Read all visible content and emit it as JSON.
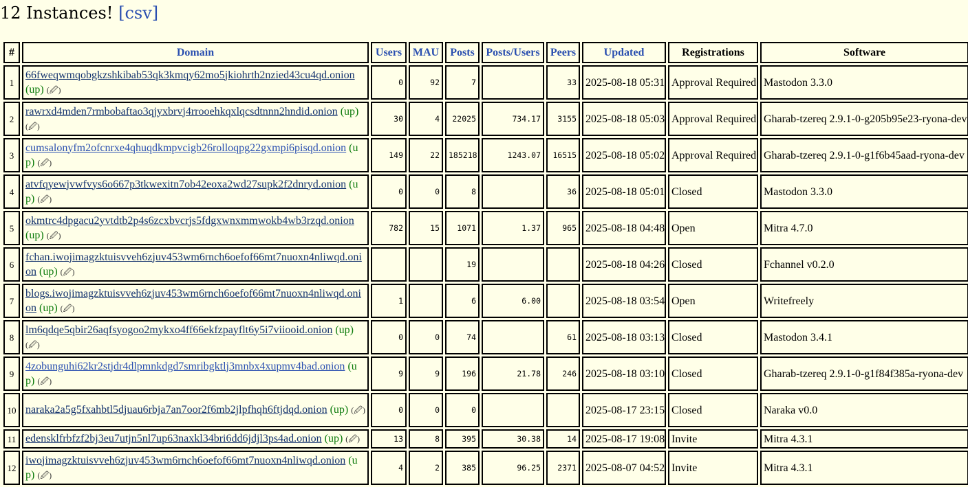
{
  "heading": {
    "count_text": "12 Instances!",
    "csv_link": "[csv]"
  },
  "columns": [
    {
      "label": "#",
      "sortable": false
    },
    {
      "label": "Domain",
      "sortable": true
    },
    {
      "label": "Users",
      "sortable": true
    },
    {
      "label": "MAU",
      "sortable": true
    },
    {
      "label": "Posts",
      "sortable": true
    },
    {
      "label": "Posts/Users",
      "sortable": true
    },
    {
      "label": "Peers",
      "sortable": true
    },
    {
      "label": "Updated",
      "sortable": true
    },
    {
      "label": "Registrations",
      "sortable": false
    },
    {
      "label": "Software",
      "sortable": false
    }
  ],
  "status_text": "(up)",
  "icons": {
    "edit": "pencil-icon"
  },
  "colors": {
    "background": "#ffffe8",
    "link": "#2a4fb0",
    "domain": "#14336e",
    "status": "#0a7a0a"
  },
  "rows": [
    {
      "num": "1",
      "domain": "66fweqwmqobgkzshkibab53qk3kmqy62mo5jkiohrth2nzied43cu4qd.onion",
      "users": "0",
      "mau": "92",
      "posts": "7",
      "posts_per_user": "",
      "peers": "33",
      "updated": "2025-08-18 05:31",
      "registrations": "Approval Required",
      "software": "Mastodon 3.3.0"
    },
    {
      "num": "2",
      "domain": "rawrxd4mden7rmbobaftao3qjyxbrvj4rrooehkqxlqcsdtnnn2hndid.onion",
      "users": "30",
      "mau": "4",
      "posts": "22025",
      "posts_per_user": "734.17",
      "peers": "3155",
      "updated": "2025-08-18 05:03",
      "registrations": "Approval Required",
      "software": "Gharab-tzereq 2.9.1-0-g205b95e23-ryona-dev"
    },
    {
      "num": "3",
      "domain": "cumsalonyfm2ofcnrxe4qhuqdkmpvcigb26rolloqpg22gxmpi6pisqd.onion",
      "users": "149",
      "mau": "22",
      "posts": "185218",
      "posts_per_user": "1243.07",
      "peers": "16515",
      "updated": "2025-08-18 05:02",
      "registrations": "Approval Required",
      "software": "Gharab-tzereq 2.9.1-0-g1f6b45aad-ryona-dev"
    },
    {
      "num": "4",
      "domain": "atvfqyewjvwfvys6o667p3tkwexitn7ob42eoxa2wd27supk2f2dnryd.onion",
      "users": "0",
      "mau": "0",
      "posts": "8",
      "posts_per_user": "",
      "peers": "36",
      "updated": "2025-08-18 05:01",
      "registrations": "Closed",
      "software": "Mastodon 3.3.0"
    },
    {
      "num": "5",
      "domain": "okmtrc4dpgacu2yvtdtb2p4s6zcxbvcrjs5fdgxwnxmmwokb4wb3rzqd.onion",
      "users": "782",
      "mau": "15",
      "posts": "1071",
      "posts_per_user": "1.37",
      "peers": "965",
      "updated": "2025-08-18 04:48",
      "registrations": "Open",
      "software": "Mitra 4.7.0"
    },
    {
      "num": "6",
      "domain": "fchan.iwojimagzktuisvveh6zjuv453wm6rnch6oefof66mt7nuoxn4nliwqd.onion",
      "users": "",
      "mau": "",
      "posts": "19",
      "posts_per_user": "",
      "peers": "",
      "updated": "2025-08-18 04:26",
      "registrations": "Closed",
      "software": "Fchannel v0.2.0"
    },
    {
      "num": "7",
      "domain": "blogs.iwojimagzktuisvveh6zjuv453wm6rnch6oefof66mt7nuoxn4nliwqd.onion",
      "users": "1",
      "mau": "",
      "posts": "6",
      "posts_per_user": "6.00",
      "peers": "",
      "updated": "2025-08-18 03:54",
      "registrations": "Open",
      "software": "Writefreely"
    },
    {
      "num": "8",
      "domain": "lm6qdqe5qbir26aqfsyogoo2mykxo4ff66ekfzpayflt6y5i7viiooid.onion",
      "users": "0",
      "mau": "0",
      "posts": "74",
      "posts_per_user": "",
      "peers": "61",
      "updated": "2025-08-18 03:13",
      "registrations": "Closed",
      "software": "Mastodon 3.4.1"
    },
    {
      "num": "9",
      "domain": "4zobunguhi62kr2stjdr4dlpmnkdgd7smribgktlj3mnbx4xupmv4bad.onion",
      "users": "9",
      "mau": "9",
      "posts": "196",
      "posts_per_user": "21.78",
      "peers": "246",
      "updated": "2025-08-18 03:10",
      "registrations": "Closed",
      "software": "Gharab-tzereq 2.9.1-0-g1f84f385a-ryona-dev"
    },
    {
      "num": "10",
      "domain": "naraka2a5g5fxahbtl5djuau6rbja7an7oor2f6mb2jlpfhqh6ftjdqd.onion",
      "users": "0",
      "mau": "0",
      "posts": "0",
      "posts_per_user": "",
      "peers": "",
      "updated": "2025-08-17 23:15",
      "registrations": "Closed",
      "software": "Naraka v0.0"
    },
    {
      "num": "11",
      "domain": "edensklfrbfzf2bj3eu7utjn5nl7up63naxkl34bri6dd6jdjl3ps4ad.onion",
      "users": "13",
      "mau": "8",
      "posts": "395",
      "posts_per_user": "30.38",
      "peers": "14",
      "updated": "2025-08-17 19:08",
      "registrations": "Invite",
      "software": "Mitra 4.3.1"
    },
    {
      "num": "12",
      "domain": "iwojimagzktuisvveh6zjuv453wm6rnch6oefof66mt7nuoxn4nliwqd.onion",
      "users": "4",
      "mau": "2",
      "posts": "385",
      "posts_per_user": "96.25",
      "peers": "2371",
      "updated": "2025-08-07 04:52",
      "registrations": "Invite",
      "software": "Mitra 4.3.1"
    }
  ]
}
